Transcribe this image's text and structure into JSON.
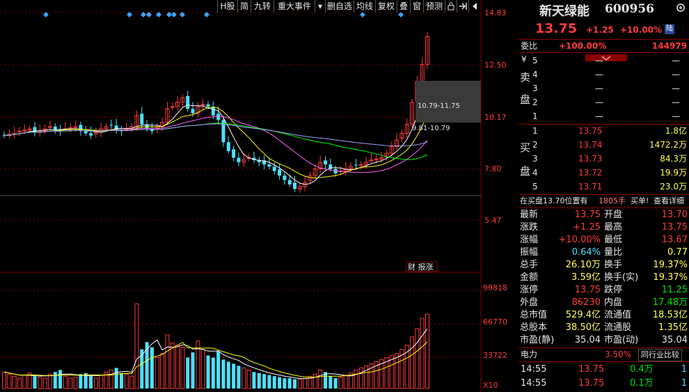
{
  "toolbar": {
    "items": [
      "H股",
      "简",
      "九转",
      "重大事件",
      "▾",
      "删自选",
      "均线",
      "复权",
      "叠",
      "窗",
      "预测",
      "锁",
      "⇥",
      "◀"
    ]
  },
  "chart": {
    "price_ticks": [
      "14.83",
      "12.50",
      "10.17",
      "7.80",
      "5.47"
    ],
    "volume_ticks": [
      "99818",
      "66770",
      "33722",
      "X10"
    ],
    "annotation_upper": "10.79-11.75",
    "annotation_lower": "9.81-10.79",
    "badge": "财 报涨",
    "colors": {
      "up": "#ff3c3c",
      "down": "#4be1ff",
      "ma5": "#ffffff",
      "ma10": "#ffff00",
      "ma20": "#ff66ff",
      "ma60": "#00ff00",
      "ma120": "#a0a0ff"
    }
  },
  "header": {
    "name": "新天绿能",
    "code": "600956",
    "price": "13.75",
    "change": "+1.25",
    "pct": "+10.00%",
    "tag": "陆"
  },
  "order_ratio": {
    "label": "委比",
    "pct": "+100.00%",
    "diff": "144979"
  },
  "sell": {
    "label_a": "卖",
    "label_b": "盘",
    "symbol": "¥",
    "levels": [
      {
        "n": "5",
        "price": "—",
        "vol": "—"
      },
      {
        "n": "4",
        "price": "—",
        "vol": "—"
      },
      {
        "n": "3",
        "price": "—",
        "vol": "—"
      },
      {
        "n": "2",
        "price": "—",
        "vol": "—"
      },
      {
        "n": "1",
        "price": "—",
        "vol": "—"
      }
    ]
  },
  "buy": {
    "label_a": "买",
    "label_b": "盘",
    "levels": [
      {
        "n": "1",
        "price": "13.75",
        "vol": "1.8亿"
      },
      {
        "n": "2",
        "price": "13.74",
        "vol": "1472.2万"
      },
      {
        "n": "3",
        "price": "13.73",
        "vol": "84.3万"
      },
      {
        "n": "4",
        "price": "13.72",
        "vol": "19.9万"
      },
      {
        "n": "5",
        "price": "13.71",
        "vol": "23.0万"
      }
    ]
  },
  "position_info": {
    "text": "在买盘13.70位置有",
    "count": "1805手",
    "suffix": "买单!",
    "link": "查看详细"
  },
  "stats": [
    {
      "l1": "最新",
      "v1": "13.75",
      "c1": "red",
      "l2": "开盘",
      "v2": "13.70",
      "c2": "red"
    },
    {
      "l1": "涨跌",
      "v1": "+1.25",
      "c1": "red",
      "l2": "最高",
      "v2": "13.75",
      "c2": "red"
    },
    {
      "l1": "涨幅",
      "v1": "+10.00%",
      "c1": "red",
      "l2": "最低",
      "v2": "13.67",
      "c2": "red"
    },
    {
      "l1": "振幅",
      "v1": "0.64%",
      "c1": "cyn",
      "l2": "量比",
      "v2": "0.77",
      "c2": "yel"
    },
    {
      "l1": "总手",
      "v1": "26.10万",
      "c1": "yel",
      "l2": "换手",
      "v2": "19.37%",
      "c2": "yel"
    },
    {
      "l1": "金额",
      "v1": "3.59亿",
      "c1": "yel",
      "l2": "换手(实)",
      "v2": "19.37%",
      "c2": "yel"
    },
    {
      "l1": "涨停",
      "v1": "13.75",
      "c1": "red",
      "l2": "跌停",
      "v2": "11.25",
      "c2": "grn"
    },
    {
      "l1": "外盘",
      "v1": "86230",
      "c1": "red",
      "l2": "内盘",
      "v2": "17.48万",
      "c2": "grn"
    },
    {
      "l1": "总市值",
      "v1": "529.4亿",
      "c1": "yel",
      "l2": "流通值",
      "v2": "18.53亿",
      "c2": "yel"
    },
    {
      "l1": "总股本",
      "v1": "38.50亿",
      "c1": "yel",
      "l2": "流通股",
      "v2": "1.35亿",
      "c2": "yel"
    },
    {
      "l1": "市盈(静)",
      "v1": "35.04",
      "c1": "wht",
      "l2": "市盈(动)",
      "v2": "35.04",
      "c2": "wht"
    }
  ],
  "industry": {
    "name": "电力",
    "pct": "3.50%",
    "button": "同行业比较"
  },
  "ticks": [
    {
      "time": "14:55",
      "price": "13.75",
      "vol": "0.4万",
      "n": "1"
    },
    {
      "time": "14:55",
      "price": "13.75",
      "vol": "0.1万",
      "n": "1"
    }
  ]
}
